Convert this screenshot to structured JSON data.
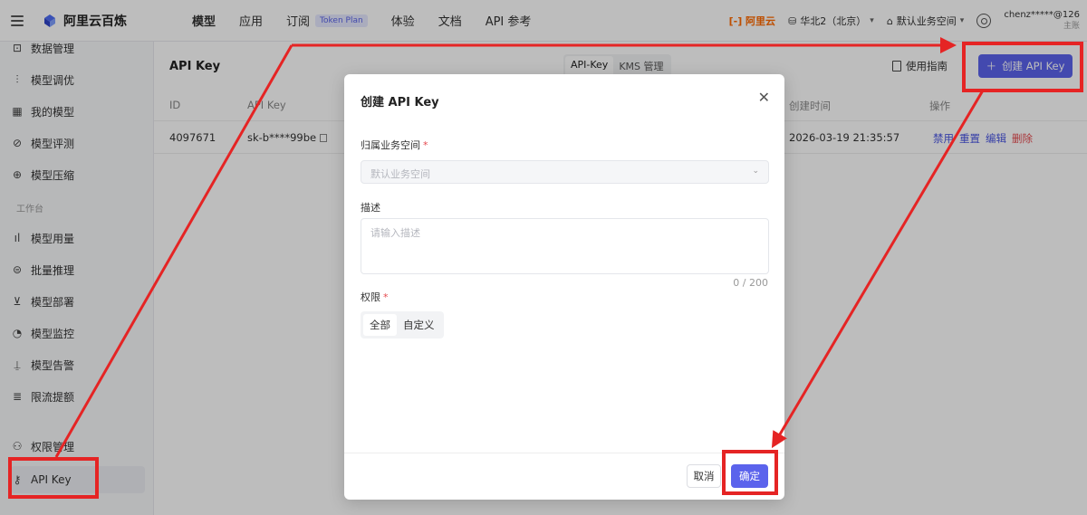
{
  "topbar": {
    "brand": "阿里云百炼",
    "nav": [
      {
        "label": "模型",
        "active": true
      },
      {
        "label": "应用"
      },
      {
        "label": "订阅",
        "badge": "Token Plan"
      },
      {
        "label": "体验"
      },
      {
        "label": "文档"
      },
      {
        "label": "API 参考"
      }
    ],
    "aliyun_logo": "[-] 阿里云",
    "region": "华北2（北京）",
    "workspace": "默认业务空间",
    "user_name": "chenz*****@126",
    "user_role": "主账"
  },
  "sidebar": {
    "items": [
      {
        "icon": "chart-icon",
        "glyph": "⊡",
        "label": "数据管理"
      },
      {
        "icon": "tune-icon",
        "glyph": "⫶",
        "label": "模型调优"
      },
      {
        "icon": "grid-icon",
        "glyph": "▦",
        "label": "我的模型"
      },
      {
        "icon": "evaluate-icon",
        "glyph": "⊘",
        "label": "模型评测"
      },
      {
        "icon": "compress-icon",
        "glyph": "⊕",
        "label": "模型压缩"
      }
    ],
    "section": "工作台",
    "items2": [
      {
        "icon": "usage-icon",
        "glyph": "ıl",
        "label": "模型用量"
      },
      {
        "icon": "batch-icon",
        "glyph": "⊜",
        "label": "批量推理"
      },
      {
        "icon": "deploy-icon",
        "glyph": "⊻",
        "label": "模型部署"
      },
      {
        "icon": "monitor-icon",
        "glyph": "◔",
        "label": "模型监控"
      },
      {
        "icon": "alert-icon",
        "glyph": "⍊",
        "label": "模型告警"
      },
      {
        "icon": "quota-icon",
        "glyph": "≣",
        "label": "限流提额"
      }
    ],
    "items3": [
      {
        "icon": "permission-icon",
        "glyph": "⚇",
        "label": "权限管理"
      },
      {
        "icon": "key-icon",
        "glyph": "⚷",
        "label": "API Key",
        "active": true
      }
    ]
  },
  "content": {
    "title": "API Key",
    "tabs": [
      "API-Key",
      "KMS 管理"
    ],
    "guide": "使用指南",
    "create_button": "创建 API Key",
    "table": {
      "headers": [
        "ID",
        "API Key",
        "创建时间",
        "操作"
      ],
      "row": {
        "id": "4097671",
        "api_key": "sk-b****99be",
        "created": "2026-03-19 21:35:57",
        "actions": [
          "禁用",
          "重置",
          "编辑",
          "删除"
        ]
      }
    }
  },
  "modal": {
    "title": "创建 API Key",
    "workspace_label": "归属业务空间",
    "workspace_placeholder": "默认业务空间",
    "desc_label": "描述",
    "desc_placeholder": "请输入描述",
    "counter": "0 / 200",
    "perm_label": "权限",
    "perm_options": [
      "全部",
      "自定义"
    ],
    "cancel": "取消",
    "ok": "确定"
  },
  "colors": {
    "accent": "#5b63ec",
    "annotation": "#e52424",
    "danger": "#e5484d"
  }
}
